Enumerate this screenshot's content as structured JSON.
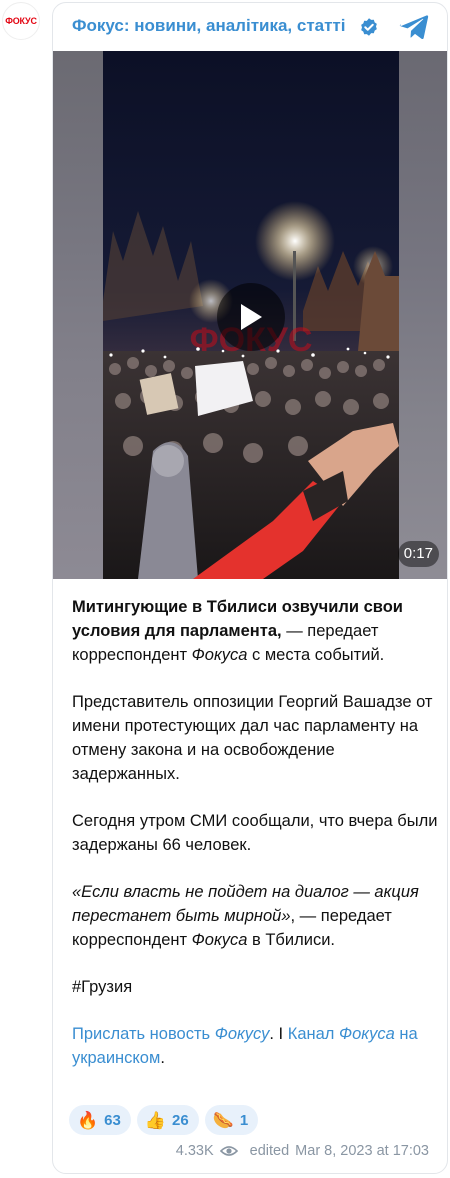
{
  "channel": {
    "avatar_text": "ФОКУС",
    "title": "Фокус: новини, аналітика, статті",
    "verified_icon": "verified-check-icon",
    "telegram_icon": "telegram-plane-icon"
  },
  "video": {
    "duration": "0:17",
    "watermark": "ФОКУС",
    "play_icon": "play-icon"
  },
  "post": {
    "p1_bold": "Митингующие в Тбилиси озвучили свои условия для парламента,",
    "p1_rest_a": " — передает корреспондент ",
    "p1_italic": "Фокуса",
    "p1_rest_b": " с места событий.",
    "p2": "Представитель оппозиции Георгий Вашадзе от имени протестующих дал час парламенту на отмену закона и на освобождение задержанных.",
    "p3": "Сегодня утром СМИ сообщали, что вчера были задержаны 66 человек.",
    "p4_italic": "«Если власть не пойдет на диалог — акция перестанет быть мирной»",
    "p4_rest_a": ", — передает корреспондент ",
    "p4_italic2": "Фокуса",
    "p4_rest_b": " в Тбилиси.",
    "hashtag": "#Грузия",
    "link1_a": "Прислать новость ",
    "link1_italic": "Фокусу",
    "sep": ". I ",
    "link2_a": "Канал ",
    "link2_italic": "Фокуса",
    "link2_b": " на украинском",
    "end_dot": "."
  },
  "reactions": [
    {
      "emoji": "🔥",
      "icon": "fire-icon",
      "count": "63"
    },
    {
      "emoji": "👍",
      "icon": "thumbs-up-icon",
      "count": "26"
    },
    {
      "emoji": "🌭",
      "icon": "hotdog-icon",
      "count": "1"
    }
  ],
  "meta": {
    "views": "4.33K",
    "views_icon": "eye-icon",
    "edited": "edited",
    "date": "Mar 8, 2023 at 17:03"
  },
  "colors": {
    "link": "#3a8ed1",
    "reaction_bg": "#e8f1fb",
    "meta": "#8a96a3",
    "brand_red": "#e30613"
  }
}
